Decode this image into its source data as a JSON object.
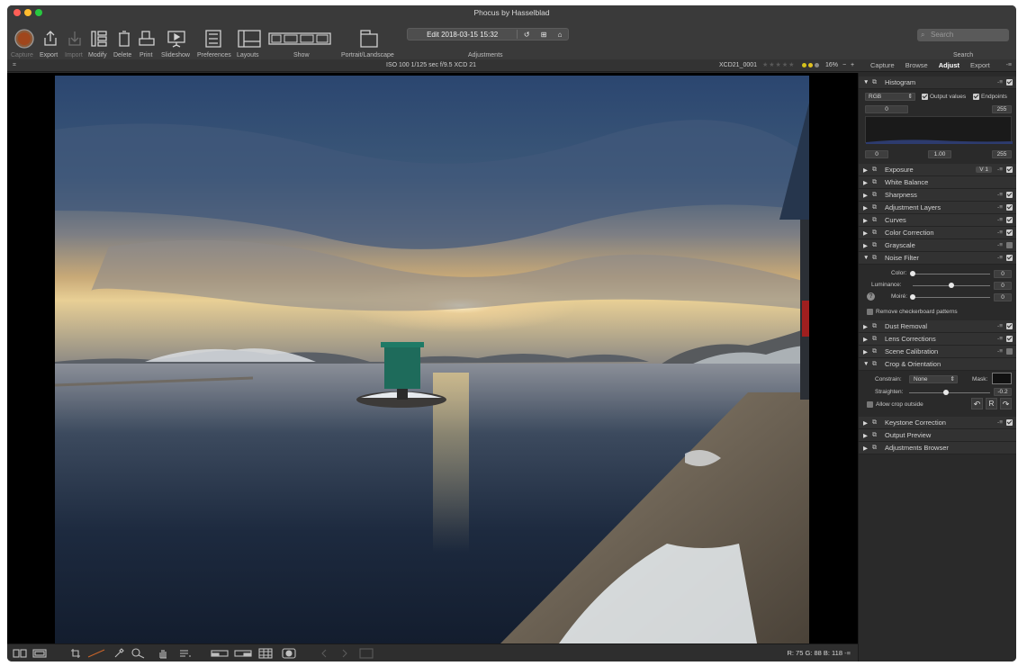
{
  "window": {
    "title": "Phocus by Hasselblad"
  },
  "toolbar": {
    "buttons": [
      {
        "id": "capture",
        "label": "Capture",
        "enabled": false
      },
      {
        "id": "export",
        "label": "Export",
        "enabled": true
      },
      {
        "id": "import",
        "label": "Import",
        "enabled": false
      },
      {
        "id": "modify",
        "label": "Modify",
        "enabled": true
      },
      {
        "id": "delete",
        "label": "Delete",
        "enabled": true
      },
      {
        "id": "print",
        "label": "Print",
        "enabled": true
      },
      {
        "id": "slideshow",
        "label": "Slideshow",
        "enabled": true
      },
      {
        "id": "preferences",
        "label": "Preferences",
        "enabled": true
      },
      {
        "id": "layouts",
        "label": "Layouts",
        "enabled": true
      }
    ],
    "show_label": "Show",
    "portrait_label": "Portrait/Landscape",
    "edit_text": "Edit 2018-03-15 15:32",
    "adjustments_label": "Adjustments",
    "search_placeholder": "Search",
    "search_label": "Search"
  },
  "info": {
    "exif": "ISO 100  1/125 sec  f/9.5  XCD 21",
    "filename": "XCD21_0001",
    "zoom": "16%",
    "minus": "−",
    "plus": "+"
  },
  "tabs": [
    "Capture",
    "Browse",
    "Adjust",
    "Export"
  ],
  "active_tab": "Adjust",
  "histogram": {
    "title": "Histogram",
    "channel": "RGB",
    "output_values_label": "Output values",
    "endpoints_label": "Endpoints",
    "in_low": "0",
    "in_high": "255",
    "out_low": "0",
    "gamma": "1.00",
    "out_high": "255"
  },
  "tools_top": [
    {
      "name": "Exposure",
      "badge": "V 1",
      "checked": true
    },
    {
      "name": "White Balance",
      "checked": null
    },
    {
      "name": "Sharpness",
      "checked": true
    },
    {
      "name": "Adjustment Layers",
      "checked": true
    },
    {
      "name": "Curves",
      "checked": true
    },
    {
      "name": "Color Correction",
      "checked": true
    },
    {
      "name": "Grayscale",
      "checked": false
    },
    {
      "name": "Noise Filter",
      "checked": true,
      "expanded": true
    }
  ],
  "noise": {
    "color_label": "Color:",
    "color_value": "0",
    "color_pos": 0,
    "luminance_label": "Luminance:",
    "luminance_value": "0",
    "luminance_pos": 0.5,
    "moire_label": "Moiré:",
    "moire_value": "0",
    "moire_pos": 0,
    "remove_checker": "Remove checkerboard patterns"
  },
  "tools_mid": [
    {
      "name": "Dust Removal",
      "checked": true
    },
    {
      "name": "Lens Corrections",
      "checked": true
    },
    {
      "name": "Scene Calibration",
      "checked": false
    },
    {
      "name": "Crop & Orientation",
      "checked": null,
      "expanded": true
    }
  ],
  "crop": {
    "constrain_label": "Constrain:",
    "constrain_value": "None",
    "mask_label": "Mask:",
    "straighten_label": "Straighten:",
    "straighten_value": "-0.2",
    "straighten_pos": 0.45,
    "allow_outside": "Allow crop outside",
    "reset_label": "R"
  },
  "tools_bottom": [
    {
      "name": "Keystone Correction",
      "checked": true
    },
    {
      "name": "Output Preview",
      "checked": null
    },
    {
      "name": "Adjustments Browser",
      "checked": null
    }
  ],
  "readout": "R:  75  G:  88  B:  118"
}
